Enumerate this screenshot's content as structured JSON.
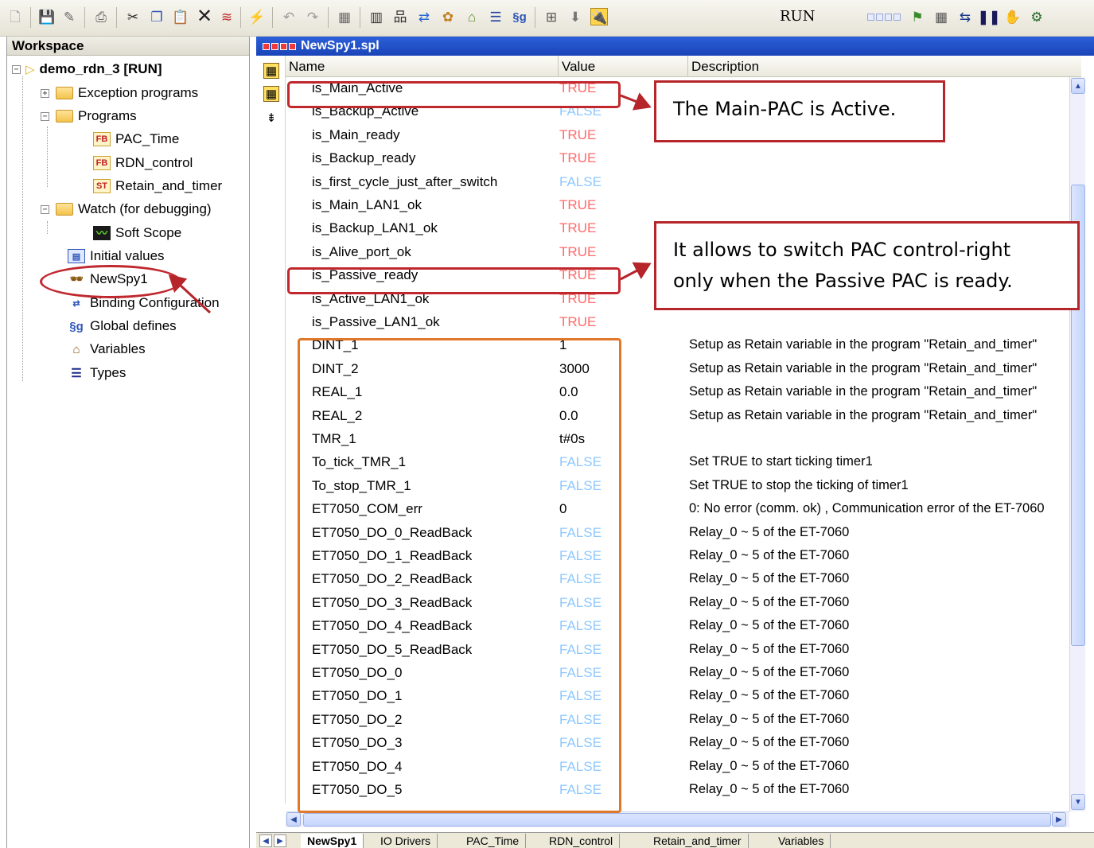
{
  "toolbar": {
    "run_label": "RUN",
    "icons": [
      "new-file-icon",
      "save-icon",
      "edit-icon",
      "print-icon",
      "cut-icon",
      "copy-icon",
      "paste-icon",
      "delete-icon",
      "clear-icon",
      "build-icon",
      "undo-icon",
      "redo-icon",
      "compile-icon",
      "table-icon",
      "network-icon",
      "binding-icon",
      "library-icon",
      "home-icon",
      "types-icon",
      "global-defines-icon",
      "layout-icon",
      "download-icon",
      "connect-icon",
      "status-leds",
      "debug-icon",
      "swap-icon",
      "pause-icon",
      "stop-icon",
      "settings-icon"
    ]
  },
  "workspace": {
    "title": "Workspace",
    "project": "demo_rdn_3 [RUN]",
    "items": [
      {
        "label": "Exception programs"
      },
      {
        "label": "Programs"
      },
      {
        "label": "PAC_Time"
      },
      {
        "label": "RDN_control"
      },
      {
        "label": "Retain_and_timer"
      },
      {
        "label": "Watch (for debugging)"
      },
      {
        "label": "Soft Scope"
      },
      {
        "label": "Initial values"
      },
      {
        "label": "NewSpy1"
      },
      {
        "label": "Binding Configuration"
      },
      {
        "label": "Global defines"
      },
      {
        "label": "Variables"
      },
      {
        "label": "Types"
      }
    ]
  },
  "spy": {
    "title": "NewSpy1.spl",
    "columns": {
      "name": "Name",
      "value": "Value",
      "description": "Description"
    },
    "rows": [
      {
        "name": "is_Main_Active",
        "value": "TRUE",
        "desc": ""
      },
      {
        "name": "is_Backup_Active",
        "value": "FALSE",
        "desc": ""
      },
      {
        "name": "is_Main_ready",
        "value": "TRUE",
        "desc": ""
      },
      {
        "name": "is_Backup_ready",
        "value": "TRUE",
        "desc": ""
      },
      {
        "name": "is_first_cycle_just_after_switch",
        "value": "FALSE",
        "desc": ""
      },
      {
        "name": "is_Main_LAN1_ok",
        "value": "TRUE",
        "desc": ""
      },
      {
        "name": "is_Backup_LAN1_ok",
        "value": "TRUE",
        "desc": ""
      },
      {
        "name": "is_Alive_port_ok",
        "value": "TRUE",
        "desc": ""
      },
      {
        "name": "is_Passive_ready",
        "value": "TRUE",
        "desc": ""
      },
      {
        "name": "is_Active_LAN1_ok",
        "value": "TRUE",
        "desc": ""
      },
      {
        "name": "is_Passive_LAN1_ok",
        "value": "TRUE",
        "desc": ""
      },
      {
        "name": "DINT_1",
        "value": "1",
        "desc": "Setup as Retain variable in the program \"Retain_and_timer\""
      },
      {
        "name": "DINT_2",
        "value": "3000",
        "desc": "Setup as Retain variable in the program \"Retain_and_timer\""
      },
      {
        "name": "REAL_1",
        "value": "0.0",
        "desc": "Setup as Retain variable in the program \"Retain_and_timer\""
      },
      {
        "name": "REAL_2",
        "value": "0.0",
        "desc": "Setup as Retain variable in the program \"Retain_and_timer\""
      },
      {
        "name": "TMR_1",
        "value": "t#0s",
        "desc": ""
      },
      {
        "name": "To_tick_TMR_1",
        "value": "FALSE",
        "desc": "Set TRUE to start ticking timer1"
      },
      {
        "name": "To_stop_TMR_1",
        "value": "FALSE",
        "desc": "Set TRUE to stop the ticking of timer1"
      },
      {
        "name": "ET7050_COM_err",
        "value": "0",
        "desc": "0: No error (comm. ok) , Communication error of the ET-7060"
      },
      {
        "name": "ET7050_DO_0_ReadBack",
        "value": "FALSE",
        "desc": "Relay_0 ~ 5 of the ET-7060"
      },
      {
        "name": "ET7050_DO_1_ReadBack",
        "value": "FALSE",
        "desc": "Relay_0 ~ 5 of the ET-7060"
      },
      {
        "name": "ET7050_DO_2_ReadBack",
        "value": "FALSE",
        "desc": "Relay_0 ~ 5 of the ET-7060"
      },
      {
        "name": "ET7050_DO_3_ReadBack",
        "value": "FALSE",
        "desc": "Relay_0 ~ 5 of the ET-7060"
      },
      {
        "name": "ET7050_DO_4_ReadBack",
        "value": "FALSE",
        "desc": "Relay_0 ~ 5 of the ET-7060"
      },
      {
        "name": "ET7050_DO_5_ReadBack",
        "value": "FALSE",
        "desc": "Relay_0 ~ 5 of the ET-7060"
      },
      {
        "name": "ET7050_DO_0",
        "value": "FALSE",
        "desc": "Relay_0 ~ 5 of the ET-7060"
      },
      {
        "name": "ET7050_DO_1",
        "value": "FALSE",
        "desc": "Relay_0 ~ 5 of the ET-7060"
      },
      {
        "name": "ET7050_DO_2",
        "value": "FALSE",
        "desc": "Relay_0 ~ 5 of the ET-7060"
      },
      {
        "name": "ET7050_DO_3",
        "value": "FALSE",
        "desc": "Relay_0 ~ 5 of the ET-7060"
      },
      {
        "name": "ET7050_DO_4",
        "value": "FALSE",
        "desc": "Relay_0 ~ 5 of the ET-7060"
      },
      {
        "name": "ET7050_DO_5",
        "value": "FALSE",
        "desc": "Relay_0 ~ 5 of the ET-7060"
      }
    ],
    "tabs": [
      "NewSpy1",
      "IO Drivers",
      "PAC_Time",
      "RDN_control",
      "Retain_and_timer",
      "Variables"
    ]
  },
  "annotations": {
    "callout_1": "The Main-PAC is Active.",
    "callout_2_line1": "It allows to switch PAC control-right",
    "callout_2_line2": "only when the Passive PAC is ready."
  },
  "colors": {
    "true_value": "#ff6a6a",
    "false_value": "#8ec8ff",
    "highlight_red": "#c0282e",
    "highlight_orange": "#e0782a",
    "title_bar": "#2b5fd9"
  }
}
